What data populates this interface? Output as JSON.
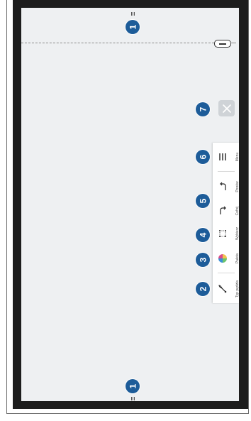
{
  "badges": {
    "top": "1",
    "bottom": "1",
    "close": "7",
    "menu": "6",
    "undo": "5",
    "select": "4",
    "palette": "3",
    "brush": "2"
  },
  "toolbar": {
    "menu_label": "Menu",
    "undo_label": "Cofnij",
    "redo_label": "Ponów",
    "select_label": "Wybierz",
    "palette_label": "Paleta",
    "brush_label": "Typ pędzla"
  },
  "icons": {
    "close": "close-icon",
    "menu": "menu-icon",
    "redo": "redo-icon",
    "undo": "undo-icon",
    "select": "select-icon",
    "palette": "palette-icon",
    "brush": "brush-icon"
  },
  "colors": {
    "badge": "#1d5c99",
    "bezel": "#1d1d1d",
    "screen": "#eef0f2"
  }
}
